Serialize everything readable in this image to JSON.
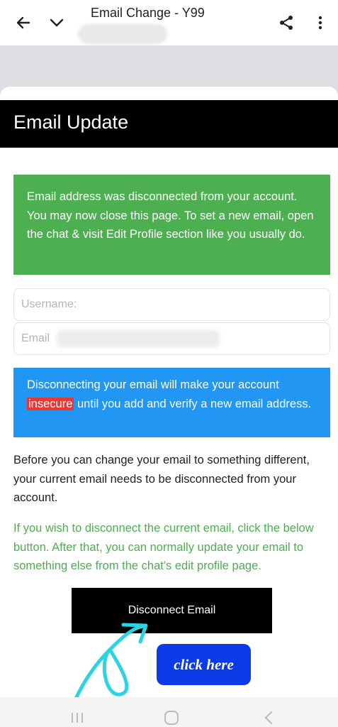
{
  "browser": {
    "title": "Email Change - Y99",
    "icons": [
      "back-arrow-icon",
      "chevron-down-icon",
      "share-icon",
      "more-vert-icon"
    ]
  },
  "page": {
    "header": "Email Update",
    "success_message": "Email address was disconnected from your account. You may now close this page. To set a new email, open the chat & visit Edit Profile section like you usually do.",
    "username_placeholder": "Username:",
    "email_placeholder": "Email",
    "warning": {
      "before": "Disconnecting your email will make your account",
      "highlight": "insecure",
      "after": "until you add and verify a new email address."
    },
    "info_paragraph": "Before you can change your email to something different, your current email needs to be disconnected from your account.",
    "instruction_paragraph": "If you wish to disconnect the current email, click the below button. After that, you can normally update your email to something else from the chat's edit profile page.",
    "disconnect_button": "Disconnect Email",
    "click_here_button": "click here"
  },
  "colors": {
    "header_bg": "#000000",
    "success_bg": "#4caf50",
    "warning_bg": "#2196f3",
    "highlight_bg": "#e53935",
    "instruction_text": "#4caf50",
    "click_here_bg": "#0b3be6",
    "annotation_arrow": "#2ad4e6"
  }
}
